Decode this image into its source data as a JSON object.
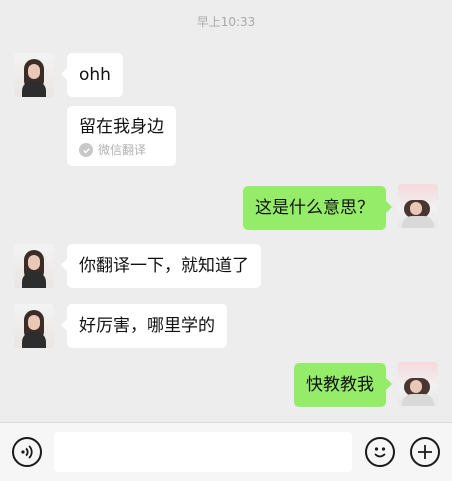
{
  "chat": {
    "timestamp": "早上10:33",
    "messages": [
      {
        "side": "left",
        "text": "ohh"
      },
      {
        "side": "left",
        "text": "留在我身边",
        "translation_label": "微信翻译"
      },
      {
        "side": "right",
        "text": "这是什么意思？"
      },
      {
        "side": "left",
        "text": "你翻译一下，就知道了"
      },
      {
        "side": "left",
        "text": "好厉害，哪里学的"
      },
      {
        "side": "right",
        "text": "快教教我"
      }
    ]
  },
  "toolbar": {
    "voice_icon": "voice-icon",
    "emoji_icon": "emoji-icon",
    "plus_icon": "plus-icon",
    "input_value": ""
  },
  "colors": {
    "background": "#ededed",
    "bubble_received": "#ffffff",
    "bubble_sent": "#95ec69"
  }
}
